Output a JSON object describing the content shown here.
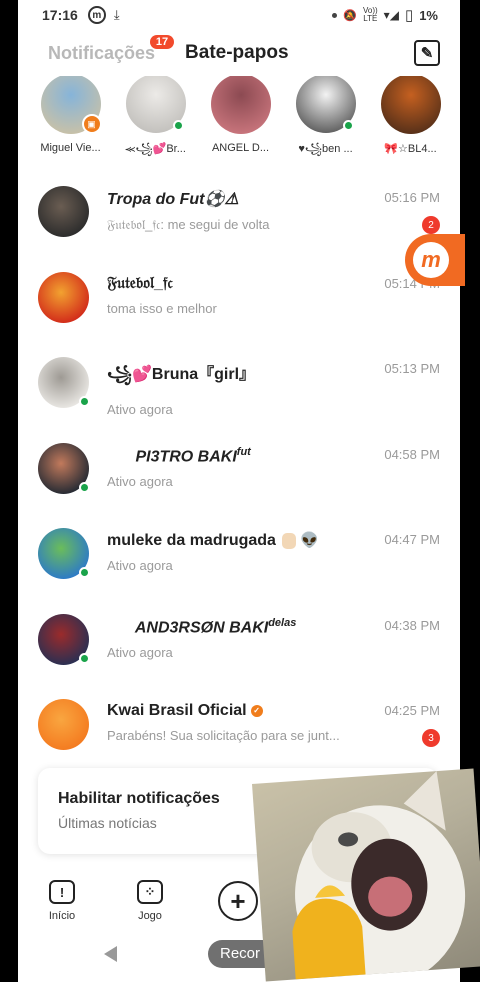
{
  "status_bar": {
    "time": "17:16",
    "app_badge": "m",
    "download_glyph": "⤓",
    "mute_glyph": "🔕",
    "lte_top": "Vo))",
    "lte_bottom": "LTE",
    "signal_glyph": "▾◢",
    "battery_glyph": "▯",
    "battery": "1%"
  },
  "header": {
    "tab_notifications": "Notificações",
    "notifications_count": "17",
    "tab_chats": "Bate-papos",
    "compose_glyph": "✎"
  },
  "stories": [
    {
      "name": "Miguel Vie...",
      "badge": "live",
      "live_glyph": "▣",
      "colors": [
        "#86b4d9",
        "#d8c49c"
      ]
    },
    {
      "name": "⪻꧁💕Br...",
      "badge": "online",
      "colors": [
        "#eceae7",
        "#b8b6b2"
      ]
    },
    {
      "name": "ANGEL D...",
      "badge": "none",
      "colors": [
        "#8c4a52",
        "#d77f86"
      ]
    },
    {
      "name": "♥꧁ben ...",
      "badge": "online",
      "colors": [
        "#f3f3f3",
        "#3a3a3a"
      ]
    },
    {
      "name": "🎀☆BL4...",
      "badge": "none",
      "colors": [
        "#c56020",
        "#3b2417"
      ]
    },
    {
      "name": "•~(",
      "badge": "none",
      "colors": [
        "#e2c8a0",
        "#a07040"
      ]
    }
  ],
  "chats": [
    {
      "name": "Tropa do Fut⚽⚠",
      "italic": true,
      "subtitle": "𝔉𝔲𝔱𝔢𝔟𝔬𝔩_𝔣𝔠: me segui de volta",
      "time": "05:16 PM",
      "unread": "2",
      "online": false,
      "colors": [
        "#2c2c2c",
        "#6a5d52"
      ]
    },
    {
      "name": "𝔉𝔲𝔱𝔢𝔟𝔬𝔩_𝔣𝔠",
      "italic": false,
      "subtitle": "toma isso e melhor",
      "time": "05:14 PM",
      "unread": "",
      "online": false,
      "colors": [
        "#d22b1a",
        "#f2a230"
      ]
    },
    {
      "name": "꧁💕Bruna『girl』",
      "italic": false,
      "subtitle": "Ativo agora",
      "time": "05:13 PM",
      "unread": "",
      "online": true,
      "colors": [
        "#e9e7e3",
        "#9e9a94"
      ]
    },
    {
      "name": "⛩⃠ PI3TRO BAKI",
      "sup": "fut",
      "italic": true,
      "subtitle": "Ativo agora",
      "time": "04:58 PM",
      "unread": "",
      "online": true,
      "colors": [
        "#252a33",
        "#c27a5c"
      ]
    },
    {
      "name": "muleke da madrugada",
      "trailing_emoji": "👽",
      "italic": false,
      "subtitle": "Ativo agora",
      "time": "04:47 PM",
      "unread": "",
      "online": true,
      "colors": [
        "#2d7ac7",
        "#6bbd5a"
      ]
    },
    {
      "name": "⛩⃠ AND3RSØN BAKI",
      "sup": "delas",
      "italic": true,
      "subtitle": "Ativo agora",
      "time": "04:38 PM",
      "unread": "",
      "online": true,
      "colors": [
        "#2a2f52",
        "#9b2b2b"
      ]
    },
    {
      "name": "Kwai Brasil Oficial",
      "verified": true,
      "verified_glyph": "✓",
      "italic": false,
      "subtitle": "Parabéns! Sua solicitação para se junt...",
      "time": "04:25 PM",
      "unread": "3",
      "online": false,
      "colors": [
        "#f47b20",
        "#f9a640"
      ]
    }
  ],
  "floating_button": {
    "label": "m"
  },
  "notification_card": {
    "title": "Habilitar notificações",
    "subtitle": "Últimas notícias"
  },
  "bottom_nav": [
    {
      "label": "Início",
      "glyph": "!"
    },
    {
      "label": "Jogo",
      "glyph": "⁘"
    },
    {
      "label": "",
      "glyph": "+"
    }
  ],
  "system_nav": {
    "record_label": "Recor"
  }
}
